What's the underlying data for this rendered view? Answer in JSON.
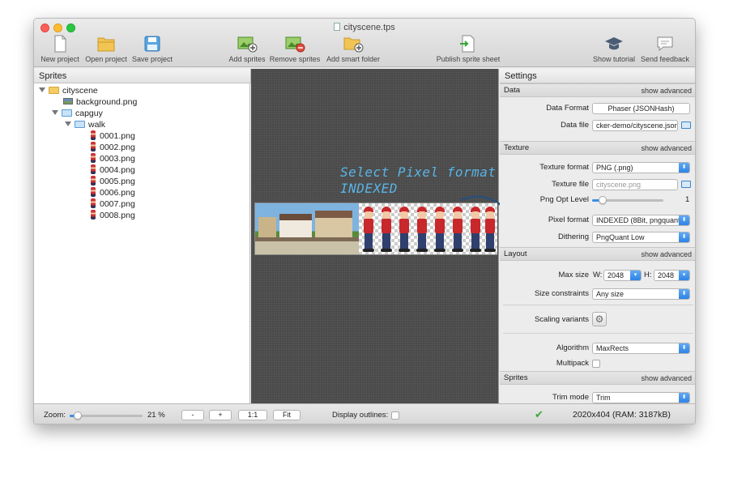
{
  "window": {
    "title": "cityscene.tps"
  },
  "toolbar": {
    "new_project": "New project",
    "open_project": "Open project",
    "save_project": "Save project",
    "add_sprites": "Add sprites",
    "remove_sprites": "Remove sprites",
    "add_smart_folder": "Add smart folder",
    "publish_sprite_sheet": "Publish sprite sheet",
    "show_tutorial": "Show tutorial",
    "send_feedback": "Send feedback"
  },
  "sprites": {
    "header": "Sprites",
    "tree": [
      {
        "label": "cityscene",
        "type": "folder"
      },
      {
        "label": "background.png",
        "type": "image"
      },
      {
        "label": "capguy",
        "type": "folder-blue"
      },
      {
        "label": "walk",
        "type": "folder-blue"
      },
      {
        "label": "0001.png",
        "type": "sprite"
      },
      {
        "label": "0002.png",
        "type": "sprite"
      },
      {
        "label": "0003.png",
        "type": "sprite"
      },
      {
        "label": "0004.png",
        "type": "sprite"
      },
      {
        "label": "0005.png",
        "type": "sprite"
      },
      {
        "label": "0006.png",
        "type": "sprite"
      },
      {
        "label": "0007.png",
        "type": "sprite"
      },
      {
        "label": "0008.png",
        "type": "sprite"
      }
    ]
  },
  "annotation": {
    "line1": "Select Pixel format",
    "line2": "INDEXED",
    "color": "#5ab4e6"
  },
  "settings": {
    "header": "Settings",
    "show_advanced": "show advanced",
    "data": {
      "title": "Data",
      "data_format_label": "Data Format",
      "data_format_value": "Phaser (JSONHash)",
      "data_file_label": "Data file",
      "data_file_value": "cker-demo/cityscene.json"
    },
    "texture": {
      "title": "Texture",
      "texture_format_label": "Texture format",
      "texture_format_value": "PNG (.png)",
      "texture_file_label": "Texture file",
      "texture_file_placeholder": "cityscene.png",
      "png_opt_label": "Png Opt Level",
      "png_opt_value": "1",
      "png_opt_level": 1,
      "pixel_format_label": "Pixel format",
      "pixel_format_value": "INDEXED (8Bit, pngquant",
      "dithering_label": "Dithering",
      "dithering_value": "PngQuant Low"
    },
    "layout": {
      "title": "Layout",
      "max_size_label": "Max size",
      "w_label": "W:",
      "w_value": "2048",
      "h_label": "H:",
      "h_value": "2048",
      "size_constraints_label": "Size constraints",
      "size_constraints_value": "Any size",
      "scaling_variants_label": "Scaling variants",
      "algorithm_label": "Algorithm",
      "algorithm_value": "MaxRects",
      "multipack_label": "Multipack"
    },
    "sprites_sec": {
      "title": "Sprites",
      "trim_mode_label": "Trim mode",
      "trim_mode_value": "Trim"
    }
  },
  "bottom": {
    "zoom_label": "Zoom:",
    "zoom_value": "21 %",
    "zoom_percent": 21,
    "minus": "-",
    "plus": "+",
    "one_to_one": "1:1",
    "fit": "Fit",
    "display_outlines": "Display outlines:",
    "status": "2020x404 (RAM: 3187kB)"
  }
}
